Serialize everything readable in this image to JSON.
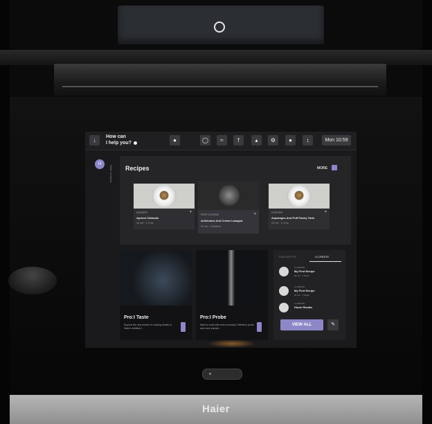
{
  "brand": "Haier",
  "screen": {
    "help": {
      "line1": "How can",
      "line2": "I help you?"
    },
    "status_icons": [
      "down-arrow-icon",
      "lock-icon",
      "timer-icon",
      "wifi-icon",
      "probe-icon",
      "bell-icon",
      "gear-icon",
      "help-icon",
      "temperature-icon"
    ],
    "time": "Mon 10:59",
    "rail": {
      "avatar_initial": "H",
      "label": "Haier Connect"
    },
    "recipes": {
      "title": "Recipes",
      "more_label": "MORE",
      "cards": [
        {
          "category": "DESSERT",
          "name": "Apricot Clafoutis",
          "meta": "45 min  ·  2-3 hrs"
        },
        {
          "category": "FIRST COURSE",
          "name": "Artichokes And Cream Lasagna",
          "meta": "30 min  ·  4 Medium"
        },
        {
          "category": "STARTER",
          "name": "Asparagus And Puff Pastry Tarts",
          "meta": "25 min  ·  2-3 hrs"
        }
      ]
    },
    "features": [
      {
        "title": "Pro:I Taste",
        "desc": "Explore the new frontier of cooking thanks to Haier's Artificial I..."
      },
      {
        "title": "Pro:I Probe",
        "desc": "Want to cook with more accuracy? Wireless probe and more precise..."
      }
    ],
    "ucreate": {
      "tabs": [
        "FAVOURITES",
        "U-CREATE"
      ],
      "items": [
        {
          "sub": "U-CREATE",
          "name": "My First Recipe",
          "meta": "60 min  ·  1 Steps"
        },
        {
          "sub": "U-CREATE",
          "name": "My First Recipe",
          "meta": "20 min  ·  1 Steps"
        },
        {
          "sub": "U-CREATE",
          "name": "Home Risotto",
          "meta": ""
        }
      ],
      "view_all": "VIEW ALL"
    }
  }
}
